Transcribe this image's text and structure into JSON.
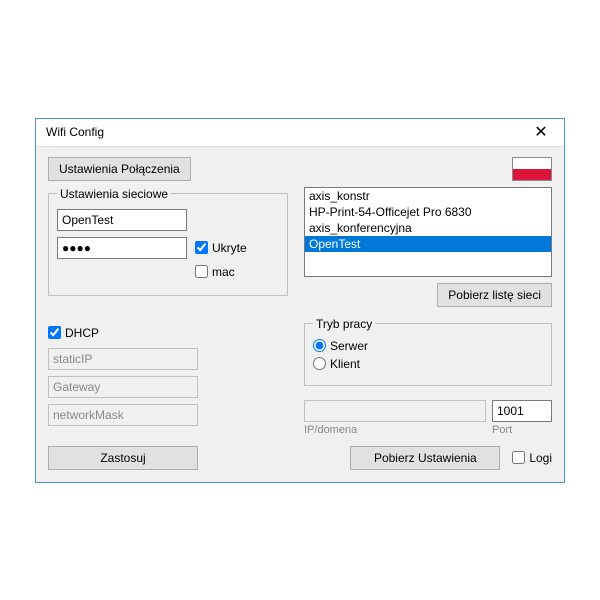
{
  "window": {
    "title": "Wifi Config"
  },
  "buttons": {
    "connection_settings": "Ustawienia Połączenia",
    "fetch_networks": "Pobierz listę sieci",
    "apply": "Zastosuj",
    "fetch_settings": "Pobierz Ustawienia"
  },
  "groups": {
    "network_settings": "Ustawienia sieciowe",
    "work_mode": "Tryb pracy"
  },
  "fields": {
    "ssid": "OpenTest",
    "password_mask": "●●●●",
    "hidden_label": "Ukryte",
    "mac_label": "mac",
    "dhcp_label": "DHCP",
    "static_ip_placeholder": "staticIP",
    "gateway_placeholder": "Gateway",
    "netmask_placeholder": "networkMask",
    "ip_label": "IP/domena",
    "port_label": "Port",
    "port_value": "1001",
    "logs_label": "Logi"
  },
  "networks": [
    "axis_konstr",
    "HP-Print-54-Officejet Pro 6830",
    "axis_konferencyjna",
    "OpenTest"
  ],
  "selected_network": "OpenTest",
  "work_mode": {
    "server": "Serwer",
    "client": "Klient",
    "selected": "server"
  },
  "checkboxes": {
    "hidden": true,
    "mac": false,
    "dhcp": true,
    "logs": false
  },
  "flag": "pl"
}
